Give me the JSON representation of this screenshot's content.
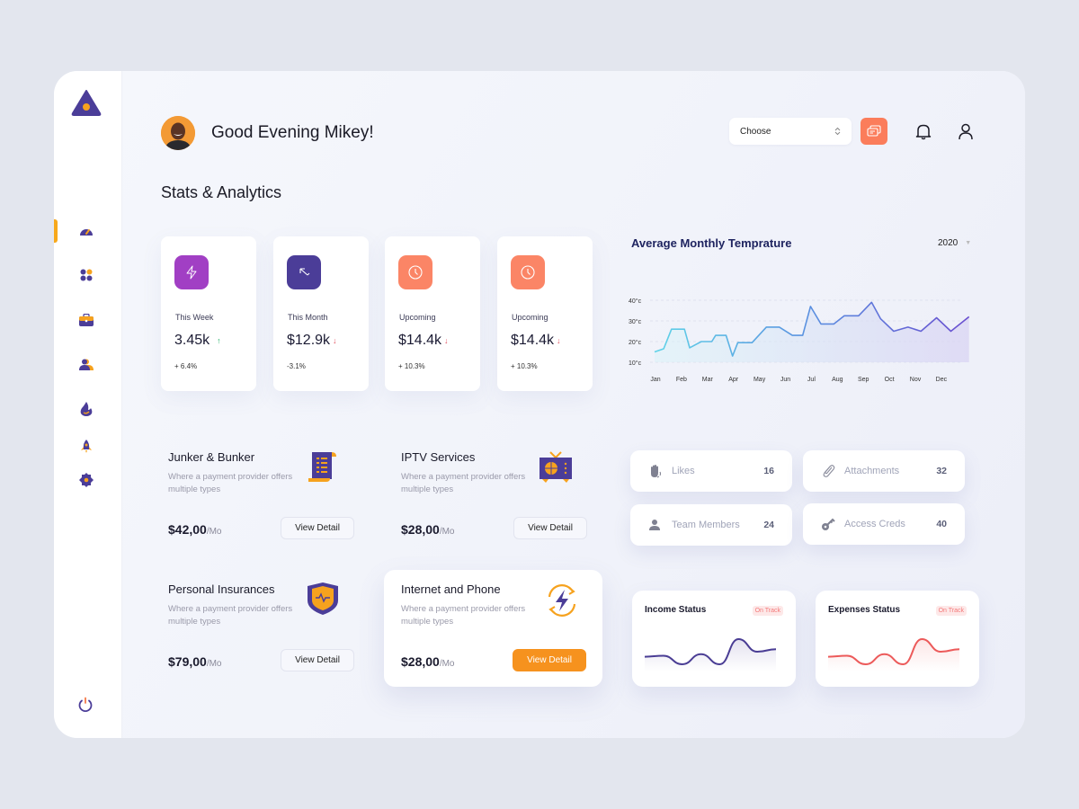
{
  "header": {
    "greeting": "Good Evening Mikey!",
    "section_title": "Stats & Analytics",
    "select_value": "Choose",
    "icons": [
      "chat-icon",
      "bell-icon",
      "user-icon"
    ]
  },
  "sidebar": {
    "logo": "triangle-logo",
    "active_index": 0,
    "items": [
      {
        "icon": "dashboard-gauge-icon"
      },
      {
        "icon": "apps-grid-icon"
      },
      {
        "icon": "briefcase-icon"
      },
      {
        "icon": "users-icon"
      },
      {
        "icon": "fire-icon"
      },
      {
        "icon": "rocket-icon"
      },
      {
        "icon": "settings-gear-icon"
      }
    ],
    "bottom_icon": "power-icon"
  },
  "stats": [
    {
      "label": "This Week",
      "value": "3.45k",
      "trend": "up",
      "arrow": "↑",
      "change": "+ 6.4%",
      "icon": "lightning-icon",
      "color": "#a13fc4"
    },
    {
      "label": "This Month",
      "value": "$12.9k",
      "trend": "down",
      "arrow": "↓",
      "change": "-3.1%",
      "icon": "arrow-up-left-icon",
      "color": "#4b3d98"
    },
    {
      "label": "Upcoming",
      "value": "$14.4k",
      "trend": "down",
      "arrow": "↓",
      "change": "+ 10.3%",
      "icon": "clock-icon",
      "color": "#fb8566"
    },
    {
      "label": "Upcoming",
      "value": "$14.4k",
      "trend": "down",
      "arrow": "↓",
      "change": "+ 10.3%",
      "icon": "clock-icon",
      "color": "#fb8566"
    }
  ],
  "chart_data": {
    "type": "line",
    "title": "Average Monthly Temprature",
    "year_select": "2020",
    "xlabel": "",
    "ylabel": "",
    "y_ticks": [
      "10°c",
      "20°c",
      "30°c",
      "40°c"
    ],
    "ylim": [
      10,
      40
    ],
    "categories": [
      "Jan",
      "Feb",
      "Mar",
      "Apr",
      "May",
      "Jun",
      "Jul",
      "Aug",
      "Sep",
      "Oct",
      "Nov",
      "Dec"
    ],
    "series": [
      {
        "name": "Temperature",
        "x_month_index": [
          0,
          0.35,
          0.65,
          1.15,
          1.35,
          1.8,
          2.2,
          2.35,
          2.75,
          3.0,
          3.2,
          3.75,
          4.3,
          4.8,
          5.3,
          5.7,
          6.0,
          6.4,
          6.9,
          7.3,
          7.85,
          8.35,
          8.7,
          9.2,
          9.75,
          10.25,
          10.85,
          11.4,
          12.1
        ],
        "values": [
          15,
          16.5,
          26,
          26,
          17,
          20,
          20,
          23,
          23,
          13,
          19.5,
          19.5,
          27,
          27,
          23,
          23,
          37,
          28.5,
          28.5,
          32.5,
          32.5,
          39,
          31,
          25,
          27,
          25,
          31.5,
          25,
          32
        ]
      }
    ],
    "grid": true,
    "colors": {
      "start": "#5fd3e8",
      "mid": "#5a8fe0",
      "end": "#6a4fd0"
    }
  },
  "plans": [
    {
      "title": "Junker & Bunker",
      "desc": "Where a payment provider offers multiple types",
      "price": "$42,00",
      "per": "/Mo",
      "button": "View Detail",
      "icon": "receipt-scroll-icon",
      "primary": false
    },
    {
      "title": "IPTV Services",
      "desc": "Where a payment provider offers multiple types",
      "price": "$28,00",
      "per": "/Mo",
      "button": "View Detail",
      "icon": "tv-icon",
      "primary": false
    },
    {
      "title": "Personal Insurances",
      "desc": "Where a payment provider offers multiple types",
      "price": "$79,00",
      "per": "/Mo",
      "button": "View Detail",
      "icon": "shield-pulse-icon",
      "primary": false
    },
    {
      "title": "Internet and Phone",
      "desc": "Where a payment provider offers multiple types",
      "price": "$28,00",
      "per": "/Mo",
      "button": "View Detail",
      "icon": "lightning-sync-icon",
      "primary": true
    }
  ],
  "counters": [
    {
      "label": "Likes",
      "count": "16",
      "icon": "clap-hand-icon"
    },
    {
      "label": "Attachments",
      "count": "32",
      "icon": "paperclip-icon"
    },
    {
      "label": "Team Members",
      "count": "24",
      "icon": "person-icon"
    },
    {
      "label": "Access Creds",
      "count": "40",
      "icon": "key-icon"
    }
  ],
  "status_cards": [
    {
      "title": "Income Status",
      "badge": "On Track",
      "color": "#4a3d94",
      "values": [
        3,
        3.2,
        1.5,
        3.5,
        1.5,
        6.5,
        4,
        4.5
      ]
    },
    {
      "title": "Expenses Status",
      "badge": "On Track",
      "color": "#ec5a5a",
      "values": [
        3,
        3.2,
        1.5,
        3.5,
        1.5,
        6.5,
        4,
        4.5
      ]
    }
  ],
  "colors": {
    "accent_orange": "#f6921e",
    "brand_purple": "#4b3d98",
    "coral": "#fb7d5b"
  }
}
